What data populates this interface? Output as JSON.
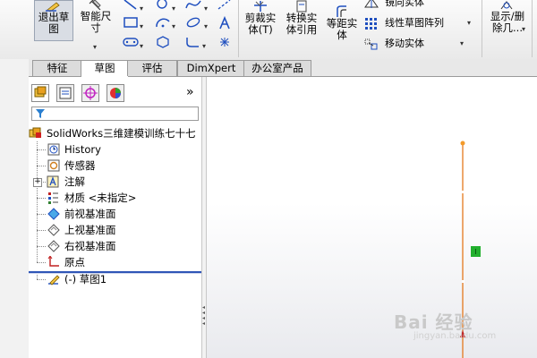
{
  "toolbar": {
    "exit_sketch": "退出草\n图",
    "smart_dimension": "智能尺\n寸",
    "trim": "剪裁实\n体(T)",
    "convert": "转换实\n体引用",
    "offset": "等距实\n体",
    "mirror": "镜向实体",
    "linear_pattern": "线性草图阵列",
    "move": "移动实体",
    "show_delete": "显示/删\n除几..."
  },
  "tabs": [
    "特征",
    "草图",
    "评估",
    "DimXpert",
    "办公室产品"
  ],
  "active_tab": "草图",
  "panel": {
    "collapse": "»",
    "tree": [
      {
        "label": "SolidWorks三维建模训练七十七"
      },
      {
        "label": "History"
      },
      {
        "label": "传感器"
      },
      {
        "label": "注解"
      },
      {
        "label": "材质 <未指定>"
      },
      {
        "label": "前视基准面"
      },
      {
        "label": "上视基准面"
      },
      {
        "label": "右视基准面"
      },
      {
        "label": "原点"
      },
      {
        "label": "(-) 草图1"
      }
    ]
  },
  "watermark": {
    "brand": "Bai 经验",
    "url": "jingyan.baidu.com"
  },
  "colors": {
    "sketch_line": "#e4791e",
    "endpoint": "#f39a2a",
    "relation": "#22b02e",
    "rollback": "#2f56b7"
  }
}
